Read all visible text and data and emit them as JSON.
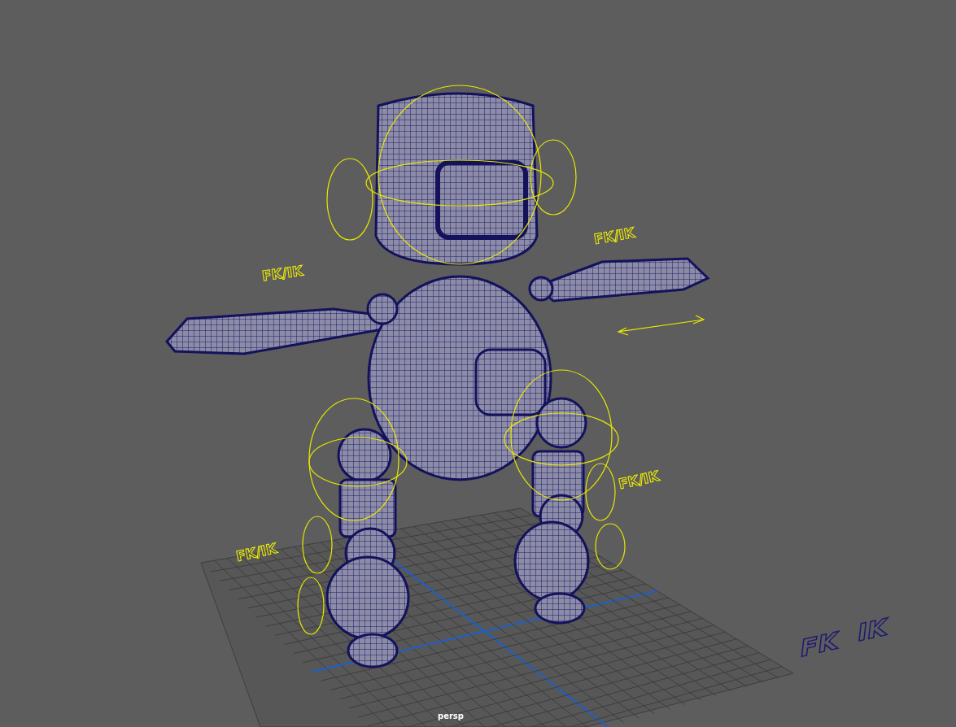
{
  "viewport": {
    "camera": "persp",
    "labels": [
      {
        "text": "FK/IK"
      },
      {
        "text": "FK/IK"
      },
      {
        "text": "FK/IK"
      },
      {
        "text": "FK/IK"
      }
    ],
    "switch_labels": [
      "FK",
      "IK"
    ]
  }
}
